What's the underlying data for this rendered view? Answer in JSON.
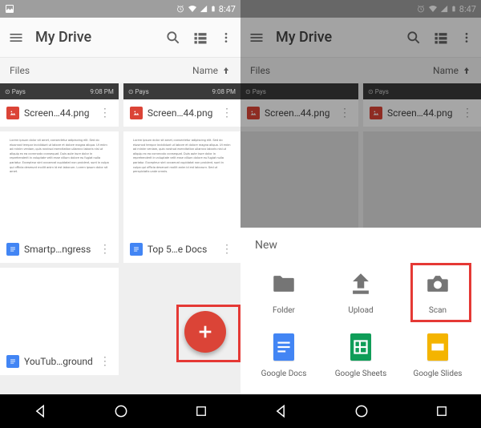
{
  "status": {
    "time": "8:47",
    "battery": "100"
  },
  "appbar": {
    "title": "My Drive"
  },
  "subhead": {
    "left": "Files",
    "right": "Name"
  },
  "thumb": {
    "left": "Pays",
    "right": "9:08 PM"
  },
  "files": [
    {
      "name": "Screen…44.png",
      "type": "image"
    },
    {
      "name": "Screen…44.png",
      "type": "image"
    },
    {
      "name": "Smartp…ngress",
      "type": "doc"
    },
    {
      "name": "Top 5…e Docs",
      "type": "doc"
    },
    {
      "name": "YouTub…ground",
      "type": "doc"
    }
  ],
  "files2": [
    {
      "name": "Screen…44.png",
      "type": "image"
    },
    {
      "name": "Screen…44.png",
      "type": "image"
    }
  ],
  "sheet": {
    "title": "New",
    "items": [
      {
        "label": "Folder"
      },
      {
        "label": "Upload"
      },
      {
        "label": "Scan"
      },
      {
        "label": "Google Docs"
      },
      {
        "label": "Google Sheets"
      },
      {
        "label": "Google Slides"
      }
    ]
  }
}
